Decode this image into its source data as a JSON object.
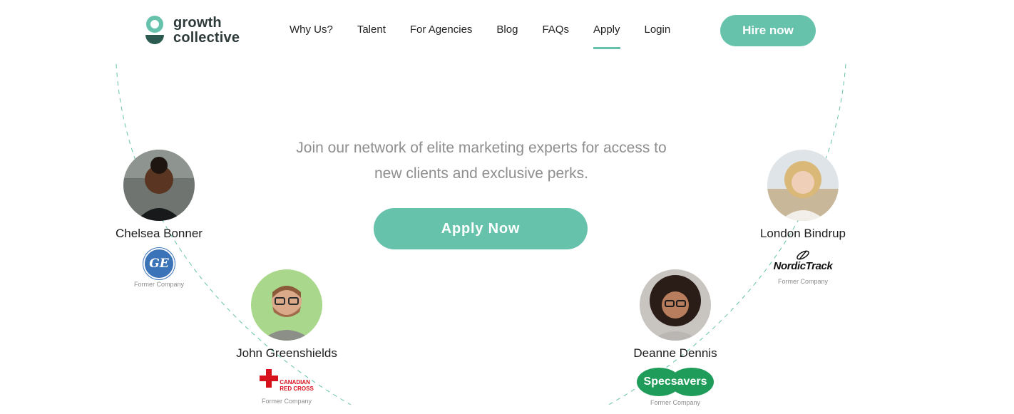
{
  "brand": {
    "line1": "growth",
    "line2": "collective",
    "color": "#66c2ab"
  },
  "nav": {
    "items": [
      {
        "label": "Why Us?"
      },
      {
        "label": "Talent"
      },
      {
        "label": "For Agencies"
      },
      {
        "label": "Blog"
      },
      {
        "label": "FAQs"
      },
      {
        "label": "Apply",
        "active": true
      },
      {
        "label": "Login"
      }
    ],
    "hire_label": "Hire now"
  },
  "hero": {
    "line1": "Join our network of elite marketing experts for access to",
    "line2": "new clients and exclusive perks.",
    "apply_label": "Apply Now"
  },
  "profiles": [
    {
      "name": "Chelsea Bonner",
      "company_logo": "GE",
      "former": "Former Company"
    },
    {
      "name": "John Greenshields",
      "company_logo": "CANADIAN RED CROSS",
      "company_line1": "CANADIAN",
      "company_line2": "RED CROSS",
      "former": "Former Company"
    },
    {
      "name": "Deanne Dennis",
      "company_logo": "Specsavers",
      "former": "Former Company"
    },
    {
      "name": "London Bindrup",
      "company_logo": "NordicTrack",
      "former": "Former Company"
    }
  ],
  "colors": {
    "accent": "#66c2ab",
    "text_muted": "#8e8e8e",
    "specsavers": "#1f9c59",
    "redcross": "#d7121d",
    "ge": "#3b73b9"
  }
}
